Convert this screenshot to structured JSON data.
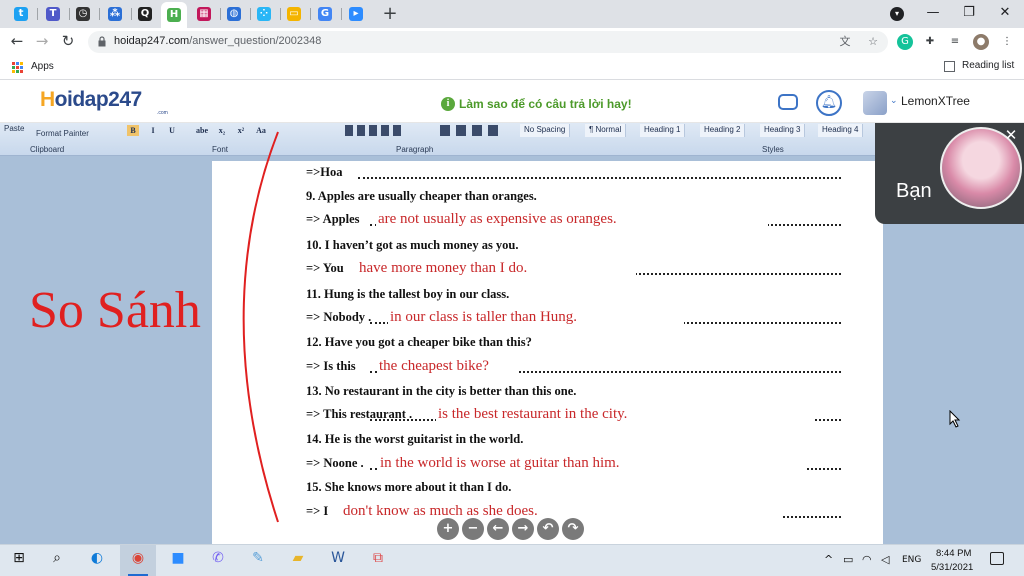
{
  "browser": {
    "tabs": [
      {
        "icon": "twitter-icon",
        "color": "#1da1f2",
        "glyph": "t"
      },
      {
        "icon": "teams-icon",
        "color": "#5059c9",
        "glyph": "T"
      },
      {
        "icon": "timer-icon",
        "color": "#333333",
        "glyph": "◷"
      },
      {
        "icon": "network-icon",
        "color": "#2b6fd6",
        "glyph": "⁂"
      },
      {
        "icon": "qanda-icon",
        "color": "#222222",
        "glyph": "Q"
      },
      {
        "icon": "hoidap-icon",
        "color": "#4caf50",
        "glyph": "H",
        "active": true
      },
      {
        "icon": "grid-app-icon",
        "color": "#c2185b",
        "glyph": "▦"
      },
      {
        "icon": "globe-icon",
        "color": "#2b6fd6",
        "glyph": "◍"
      },
      {
        "icon": "dots-app-icon",
        "color": "#29b6f6",
        "glyph": "⁘"
      },
      {
        "icon": "slides-icon",
        "color": "#f4b400",
        "glyph": "▭"
      },
      {
        "icon": "google-icon",
        "color": "#4285f4",
        "glyph": "G"
      },
      {
        "icon": "zoom-icon",
        "color": "#2d8cff",
        "glyph": "▸"
      }
    ],
    "new_tab": "+",
    "window_controls": {
      "minimize": "—",
      "restore": "❐",
      "close": "✕"
    },
    "url_domain": "hoidap247.com",
    "url_path": "/answer_question/2002348",
    "bookmarks": {
      "apps": "Apps",
      "reading_list": "Reading list"
    }
  },
  "site": {
    "logo_main": "oidap247",
    "logo_h": "H",
    "logo_sub": ".com",
    "tip_icon": "i",
    "tip_text": "Làm sao để có câu trả lời hay!",
    "username": "LemonXTree",
    "user_chevron": "⌄"
  },
  "word": {
    "ribbon": {
      "paste": "Paste",
      "format_painter": "Format Painter",
      "clipboard": "Clipboard",
      "font": "Font",
      "paragraph": "Paragraph",
      "styles": "Styles",
      "style_items": [
        "No Spacing",
        "¶ Normal",
        "Heading 1",
        "Heading 2",
        "Heading 3",
        "Heading 4"
      ],
      "font_buttons": [
        "B",
        "I",
        "U",
        "abe",
        "x₂",
        "x²",
        "Aa"
      ]
    },
    "lines": [
      {
        "text": "=>Hoa",
        "kind": "answer-line"
      },
      {
        "text": "9. Apples are usually cheaper than oranges.",
        "kind": "question"
      },
      {
        "text": "=> Apples",
        "kind": "answer-line",
        "answer": "are not usually as expensive as oranges."
      },
      {
        "text": "10. I haven’t got as much money as you.",
        "kind": "question"
      },
      {
        "text": "=> You",
        "kind": "answer-line",
        "answer": "have more money than I do."
      },
      {
        "text": "11. Hung is the tallest boy in our class.",
        "kind": "question"
      },
      {
        "text": "=> Nobody .",
        "kind": "answer-line",
        "answer": "in our class is taller than Hung."
      },
      {
        "text": "12. Have you got a cheaper bike than this?",
        "kind": "question"
      },
      {
        "text": "=> Is this",
        "kind": "answer-line",
        "answer": "the cheapest bike?"
      },
      {
        "text": "13. No restaurant in the city is better than this one.",
        "kind": "question"
      },
      {
        "text": "=> This restaurant .",
        "kind": "answer-line",
        "answer": "is the best restaurant in the city."
      },
      {
        "text": "14. He is the worst guitarist in the world.",
        "kind": "question"
      },
      {
        "text": "=> Noone .",
        "kind": "answer-line",
        "answer": "in the world is worse at guitar than him."
      },
      {
        "text": "15. She knows more about it than I do.",
        "kind": "question"
      },
      {
        "text": "=> I",
        "kind": "answer-line",
        "answer": "don't know as much as she does."
      }
    ],
    "annotation": "So Sánh"
  },
  "video_call": {
    "name": "Bạn",
    "close": "✕"
  },
  "player_buttons": [
    "+",
    "−",
    "←",
    "→",
    "↶",
    "↷"
  ],
  "taskbar": {
    "tray_lang": "ENG",
    "time": "8:44 PM",
    "date": "5/31/2021"
  }
}
